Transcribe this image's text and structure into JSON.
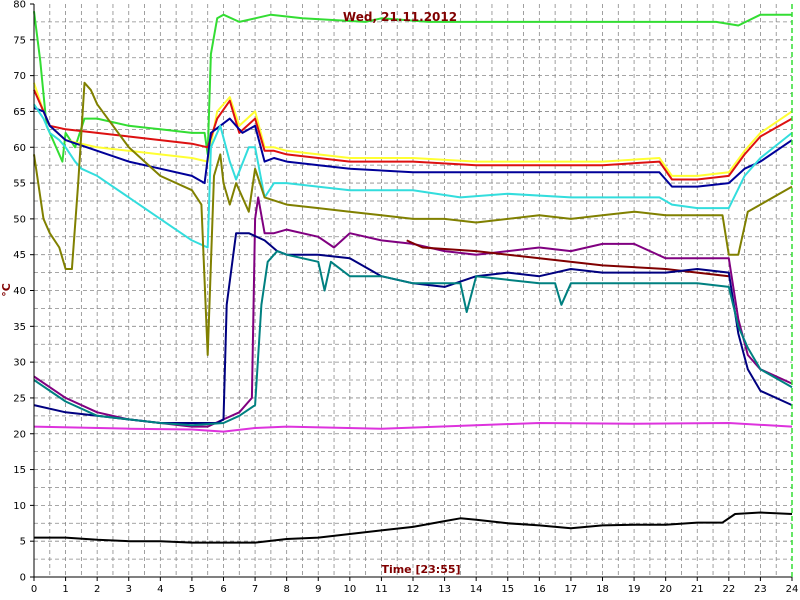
{
  "chart_data": {
    "type": "line",
    "title": "Wed, 21.11.2012",
    "xlabel": "Time [23:55]",
    "ylabel": "°C",
    "xlim": [
      0,
      24
    ],
    "ylim": [
      0,
      80
    ],
    "xticks": [
      "0",
      "1",
      "2",
      "3",
      "4",
      "5",
      "6",
      "7",
      "8",
      "9",
      "10",
      "11",
      "12",
      "13",
      "14",
      "15",
      "16",
      "17",
      "18",
      "19",
      "20",
      "21",
      "22",
      "23",
      "24"
    ],
    "yticks": [
      "0",
      "5",
      "10",
      "15",
      "20",
      "25",
      "30",
      "35",
      "40",
      "45",
      "50",
      "55",
      "60",
      "65",
      "70",
      "75",
      "80"
    ],
    "minor_x_step": 0.5,
    "minor_y_step": 2.5,
    "grid": true,
    "series": [
      {
        "color": "#33dd33",
        "x": [
          0,
          0.2,
          0.4,
          0.6,
          0.9,
          1.0,
          1.3,
          1.6,
          2.0,
          3.0,
          4.0,
          5.0,
          5.4,
          5.5,
          5.6,
          5.8,
          6.0,
          6.5,
          7.0,
          7.5,
          8.5,
          10.5,
          11,
          12.5,
          13.5,
          16,
          18,
          19.5,
          21,
          21.6,
          22.3,
          23,
          24
        ],
        "y": [
          79,
          72,
          63,
          61,
          58,
          62,
          60,
          64,
          64,
          63,
          62.5,
          62,
          62,
          59,
          73,
          78,
          78.5,
          77.5,
          78,
          78.5,
          78,
          77.5,
          78,
          77.5,
          77.5,
          77.5,
          77.5,
          77.5,
          77.5,
          77.5,
          77,
          78.5,
          78.5
        ]
      },
      {
        "color": "#ffff33",
        "x": [
          0,
          0.3,
          0.5,
          1.0,
          2.0,
          3.0,
          4.0,
          5.0,
          5.5,
          5.8,
          6.2,
          6.5,
          7.0,
          7.3,
          7.6,
          8.0,
          10,
          12,
          14,
          16,
          18,
          19.8,
          20.2,
          21,
          22,
          22.5,
          23,
          24
        ],
        "y": [
          69,
          65,
          63,
          61,
          60,
          59.5,
          59,
          58.5,
          58,
          65,
          67,
          63,
          65,
          60,
          60,
          59.5,
          58.5,
          58.5,
          58,
          58,
          58,
          58.5,
          56,
          56,
          56.5,
          59.5,
          62,
          65
        ]
      },
      {
        "color": "#dd1111",
        "x": [
          0,
          0.3,
          0.5,
          1.0,
          2.0,
          3.0,
          4.0,
          5.0,
          5.5,
          5.8,
          6.2,
          6.5,
          7.0,
          7.3,
          7.6,
          8.0,
          10,
          12,
          14,
          16,
          18,
          19.8,
          20.2,
          21,
          22,
          22.5,
          23,
          24
        ],
        "y": [
          68,
          65,
          63,
          62.5,
          62,
          61.5,
          61,
          60.5,
          60,
          64,
          66.5,
          62,
          64,
          59.5,
          59.5,
          59,
          58,
          58,
          57.5,
          57.5,
          57.5,
          58,
          55.5,
          55.5,
          56,
          59,
          61.5,
          64
        ]
      },
      {
        "color": "#000099",
        "x": [
          0,
          0.3,
          0.5,
          1.0,
          2.0,
          3.0,
          4.0,
          5.0,
          5.4,
          5.6,
          5.9,
          6.2,
          6.6,
          7.0,
          7.3,
          7.6,
          8.0,
          10,
          12,
          14,
          16,
          18,
          19.8,
          20.2,
          21,
          22,
          22.5,
          23,
          24
        ],
        "y": [
          65.5,
          65,
          63,
          61,
          59.5,
          58,
          57,
          56,
          55,
          62,
          63,
          64,
          62,
          63,
          58,
          58.5,
          58,
          57,
          56.5,
          56.5,
          56.5,
          56.5,
          56.5,
          54.5,
          54.5,
          55,
          57,
          58,
          61
        ]
      },
      {
        "color": "#33dddd",
        "x": [
          0,
          0.3,
          0.5,
          0.8,
          1.0,
          1.3,
          1.5,
          2.0,
          3.0,
          4.0,
          5.0,
          5.5,
          5.6,
          5.9,
          6.2,
          6.4,
          6.8,
          7.0,
          7.3,
          7.6,
          8.0,
          10,
          12,
          13.5,
          15,
          17,
          19,
          19.8,
          20.2,
          21,
          22,
          22.5,
          23,
          24
        ],
        "y": [
          66,
          64,
          62,
          61,
          60,
          58,
          57,
          56,
          53,
          50,
          47,
          46,
          60,
          63,
          58,
          55.5,
          60,
          60,
          53,
          55,
          55,
          54,
          54,
          53,
          53.5,
          53,
          53,
          53,
          52,
          51.5,
          51.5,
          56,
          58.5,
          62
        ]
      },
      {
        "color": "#808000",
        "x": [
          0,
          0.3,
          0.5,
          0.8,
          1.0,
          1.2,
          1.4,
          1.6,
          1.8,
          2.0,
          2.5,
          3.0,
          4.0,
          5.0,
          5.3,
          5.5,
          5.7,
          5.9,
          6.0,
          6.2,
          6.4,
          6.8,
          7.0,
          7.3,
          8.0,
          9,
          10,
          11,
          12,
          13,
          14,
          15,
          16,
          17,
          18,
          19,
          20,
          21,
          21.8,
          22.0,
          22.3,
          22.6,
          23,
          24
        ],
        "y": [
          59,
          50,
          48,
          46,
          43,
          43,
          55,
          69,
          68,
          66,
          63,
          60,
          56,
          54,
          52,
          31,
          56,
          59,
          55,
          52,
          55,
          51,
          57,
          53,
          52,
          51.5,
          51,
          50.5,
          50,
          50,
          49.5,
          50,
          50.5,
          50,
          50.5,
          51,
          50.5,
          50.5,
          50.5,
          45,
          45,
          51,
          52,
          54.5
        ]
      },
      {
        "color": "#800080",
        "x": [
          0,
          1.0,
          2.0,
          3.0,
          4.0,
          5.0,
          5.5,
          6.0,
          6.5,
          6.9,
          7.0,
          7.1,
          7.3,
          7.6,
          8.0,
          9.0,
          9.5,
          10,
          11,
          12,
          13,
          14,
          15,
          16,
          17,
          18,
          19,
          20,
          21,
          22,
          22.3,
          22.6,
          23,
          24
        ],
        "y": [
          28,
          25,
          23,
          22,
          21.5,
          21,
          21,
          22,
          23,
          25,
          50,
          53,
          48,
          48,
          48.5,
          47.5,
          46,
          48,
          47,
          46.5,
          45.5,
          45,
          45.5,
          46,
          45.5,
          46.5,
          46.5,
          44.5,
          44.5,
          44.5,
          36,
          31,
          29,
          27
        ]
      },
      {
        "color": "#800000",
        "x": [
          11.8,
          12.3,
          14,
          16,
          18,
          20,
          22
        ],
        "y": [
          47,
          46,
          45.5,
          44.5,
          43.5,
          43,
          42
        ]
      },
      {
        "color": "#000080",
        "x": [
          0,
          1.0,
          2.0,
          3.0,
          4.0,
          5.0,
          5.8,
          6.0,
          6.1,
          6.4,
          6.8,
          7.3,
          7.7,
          8.0,
          9.0,
          10,
          11,
          12,
          13,
          14,
          15,
          16,
          17,
          18,
          19,
          20,
          21,
          22,
          22.3,
          22.6,
          23,
          24
        ],
        "y": [
          24,
          23,
          22.5,
          22,
          21.5,
          21.5,
          21.5,
          22,
          38,
          48,
          48,
          47,
          45.5,
          45,
          45,
          44.5,
          42,
          41,
          40.5,
          42,
          42.5,
          42,
          43,
          42.5,
          42.5,
          42.5,
          43,
          42.5,
          34,
          29,
          26,
          24
        ]
      },
      {
        "color": "#008080",
        "x": [
          0,
          1.0,
          2.0,
          3.0,
          4.0,
          5.0,
          6.0,
          6.5,
          7.0,
          7.2,
          7.4,
          7.7,
          8.0,
          9.0,
          9.2,
          9.4,
          10,
          11,
          12,
          13,
          13.5,
          13.7,
          14,
          15,
          16,
          16.5,
          16.7,
          17,
          18,
          19,
          20,
          21,
          22,
          22.3,
          22.6,
          23,
          24
        ],
        "y": [
          27.5,
          24.5,
          22.5,
          22,
          21.5,
          21.2,
          21.5,
          22.5,
          24,
          38,
          44,
          45.5,
          45,
          44,
          40,
          44,
          42,
          42,
          41,
          41,
          41,
          37,
          42,
          41.5,
          41,
          41,
          38,
          41,
          41,
          41,
          41,
          41,
          40.5,
          35,
          32,
          29,
          26.5
        ]
      },
      {
        "color": "#dd33dd",
        "x": [
          0,
          3,
          5,
          6,
          7,
          8,
          11,
          14,
          16,
          19,
          22,
          24
        ],
        "y": [
          21,
          20.7,
          20.6,
          20.3,
          20.8,
          21,
          20.7,
          21.2,
          21.5,
          21.4,
          21.5,
          21
        ]
      },
      {
        "color": "#000000",
        "x": [
          0,
          1,
          2,
          3,
          4,
          5,
          6,
          7,
          8,
          9,
          10,
          11,
          12,
          13,
          13.5,
          14,
          15,
          16,
          17,
          18,
          19,
          20,
          21,
          21.8,
          22.2,
          23,
          24
        ],
        "y": [
          5.5,
          5.5,
          5.2,
          5,
          5,
          4.8,
          4.8,
          4.8,
          5.3,
          5.5,
          6,
          6.5,
          7,
          7.8,
          8.2,
          8,
          7.5,
          7.2,
          6.8,
          7.2,
          7.3,
          7.3,
          7.6,
          7.6,
          8.8,
          9,
          8.8
        ]
      }
    ],
    "right_border_color": "#33dd33"
  }
}
